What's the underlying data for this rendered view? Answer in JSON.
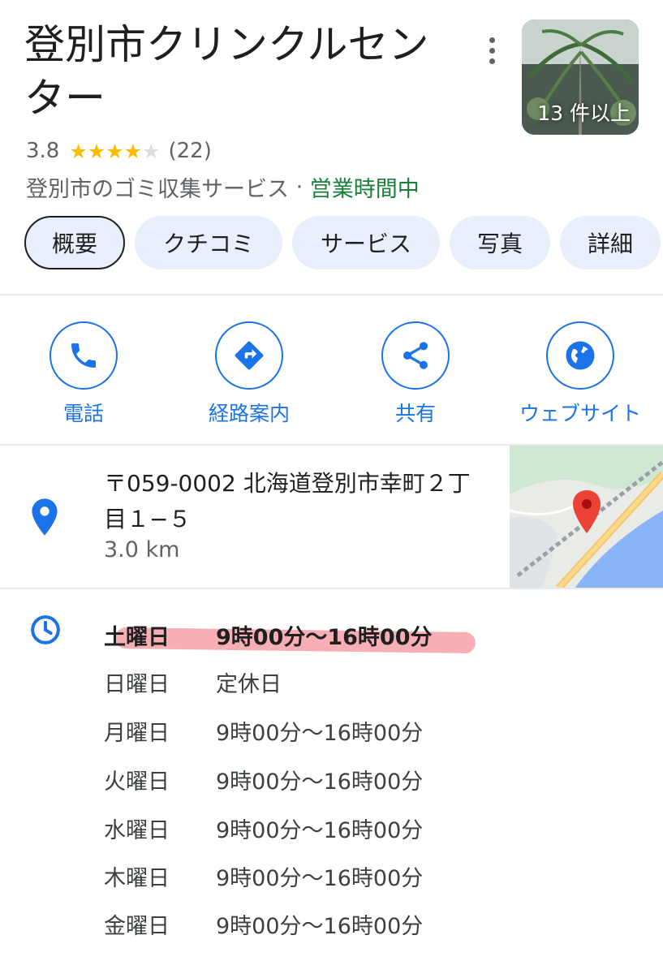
{
  "place": {
    "title": "登別市クリンクルセンター",
    "photo_count_label": "13 件以上",
    "rating": "3.8",
    "stars_filled": 4,
    "stars_total": 5,
    "review_count": "(22)",
    "category": "登別市のゴミ収集サービス",
    "separator": " · ",
    "open_status": "営業時間中"
  },
  "tabs": [
    {
      "label": "概要",
      "active": true
    },
    {
      "label": "クチコミ",
      "active": false
    },
    {
      "label": "サービス",
      "active": false
    },
    {
      "label": "写真",
      "active": false
    },
    {
      "label": "詳細",
      "active": false
    }
  ],
  "actions": [
    {
      "label": "電話",
      "icon": "phone-icon"
    },
    {
      "label": "経路案内",
      "icon": "directions-icon"
    },
    {
      "label": "共有",
      "icon": "share-icon"
    },
    {
      "label": "ウェブサイト",
      "icon": "globe-icon"
    }
  ],
  "address": {
    "text": "〒059-0002 北海道登別市幸町２丁目１−５",
    "distance": "3.0 km"
  },
  "hours": [
    {
      "day": "土曜日",
      "time": "9時00分～16時00分",
      "today": true
    },
    {
      "day": "日曜日",
      "time": "定休日",
      "today": false
    },
    {
      "day": "月曜日",
      "time": "9時00分～16時00分",
      "today": false
    },
    {
      "day": "火曜日",
      "time": "9時00分～16時00分",
      "today": false
    },
    {
      "day": "水曜日",
      "time": "9時00分～16時00分",
      "today": false
    },
    {
      "day": "木曜日",
      "time": "9時00分～16時00分",
      "today": false
    },
    {
      "day": "金曜日",
      "time": "9時00分～16時00分",
      "today": false
    }
  ],
  "colors": {
    "accent": "#1a73e8",
    "open": "#188038",
    "star": "#fbbc04",
    "highlight": "#f06e78"
  }
}
